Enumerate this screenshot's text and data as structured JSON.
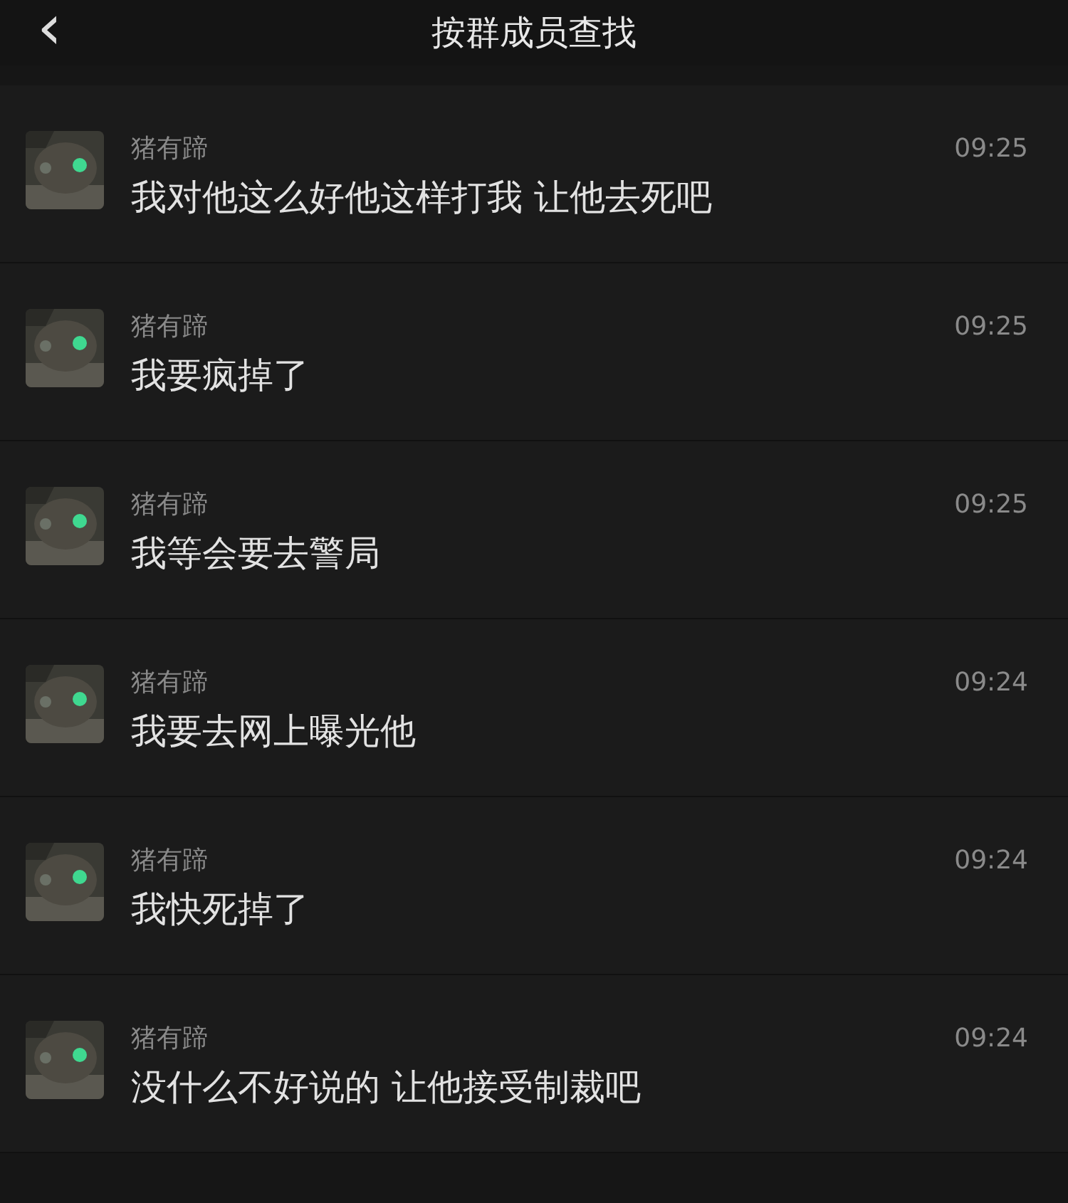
{
  "header": {
    "back_icon": "‹",
    "title": "按群成员查找"
  },
  "messages": [
    {
      "name": "猪有蹄",
      "time": "09:25",
      "text": "我对他这么好他这样打我 让他去死吧"
    },
    {
      "name": "猪有蹄",
      "time": "09:25",
      "text": "我要疯掉了"
    },
    {
      "name": "猪有蹄",
      "time": "09:25",
      "text": "我等会要去警局"
    },
    {
      "name": "猪有蹄",
      "time": "09:24",
      "text": "我要去网上曝光他"
    },
    {
      "name": "猪有蹄",
      "time": "09:24",
      "text": "我快死掉了"
    },
    {
      "name": "猪有蹄",
      "time": "09:24",
      "text": "没什么不好说的 让他接受制裁吧"
    }
  ]
}
